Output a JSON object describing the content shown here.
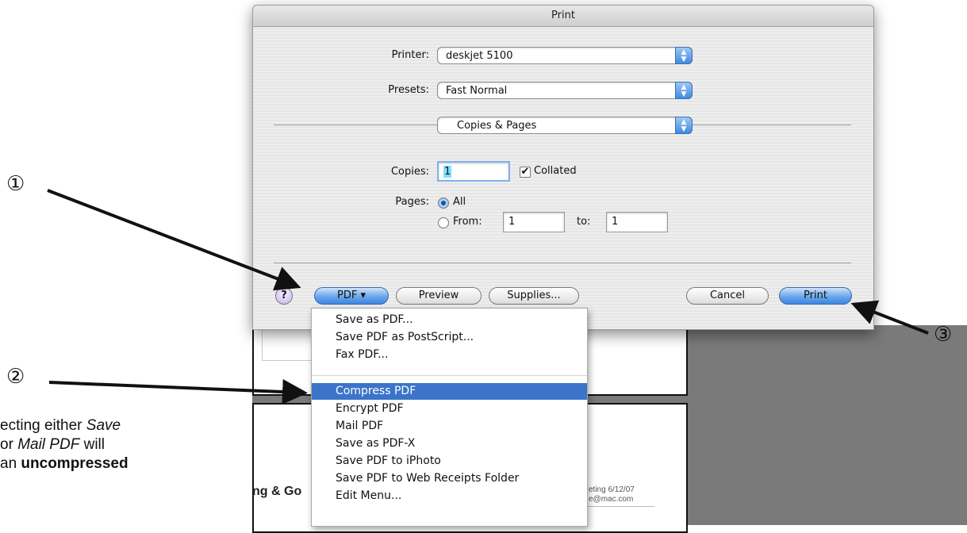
{
  "dialog": {
    "title": "Print",
    "printer_label": "Printer:",
    "printer_value": "deskjet 5100",
    "presets_label": "Presets:",
    "presets_value": "Fast Normal",
    "panel_value": "Copies & Pages",
    "copies_label": "Copies:",
    "copies_value": "1",
    "collated_label": "Collated",
    "collated_checked": true,
    "pages_label": "Pages:",
    "pages_all_label": "All",
    "pages_from_label": "From:",
    "pages_from_value": "1",
    "pages_to_label": "to:",
    "pages_to_value": "1",
    "help_label": "?",
    "pdf_button_label": "PDF ▾",
    "preview_button_label": "Preview",
    "supplies_button_label": "Supplies...",
    "cancel_button_label": "Cancel",
    "print_button_label": "Print"
  },
  "pdf_menu": {
    "group1": [
      "Save as PDF...",
      "Save PDF as PostScript...",
      "Fax PDF..."
    ],
    "group2": [
      "Compress PDF",
      "Encrypt PDF",
      "Mail PDF",
      "Save as PDF-X",
      "Save PDF to iPhoto",
      "Save PDF to Web Receipts Folder",
      "Edit Menu..."
    ],
    "selected": "Compress PDF"
  },
  "background_doc": {
    "left_text": "ng & Go",
    "right_text_line1": "eting 6/12/07",
    "right_text_line2": "e@mac.com"
  },
  "annotations": {
    "callout1": "①",
    "callout2": "②",
    "callout3": "③",
    "caption_line1_a": "ecting either ",
    "caption_line1_b": "Save",
    "caption_line2_a": " or ",
    "caption_line2_b": "Mail PDF",
    "caption_line2_c": " will",
    "caption_line3_a": "an ",
    "caption_line3_b": "uncompressed"
  },
  "colors": {
    "accent_blue": "#3b74c9",
    "menu_highlight": "#3b74c9"
  }
}
